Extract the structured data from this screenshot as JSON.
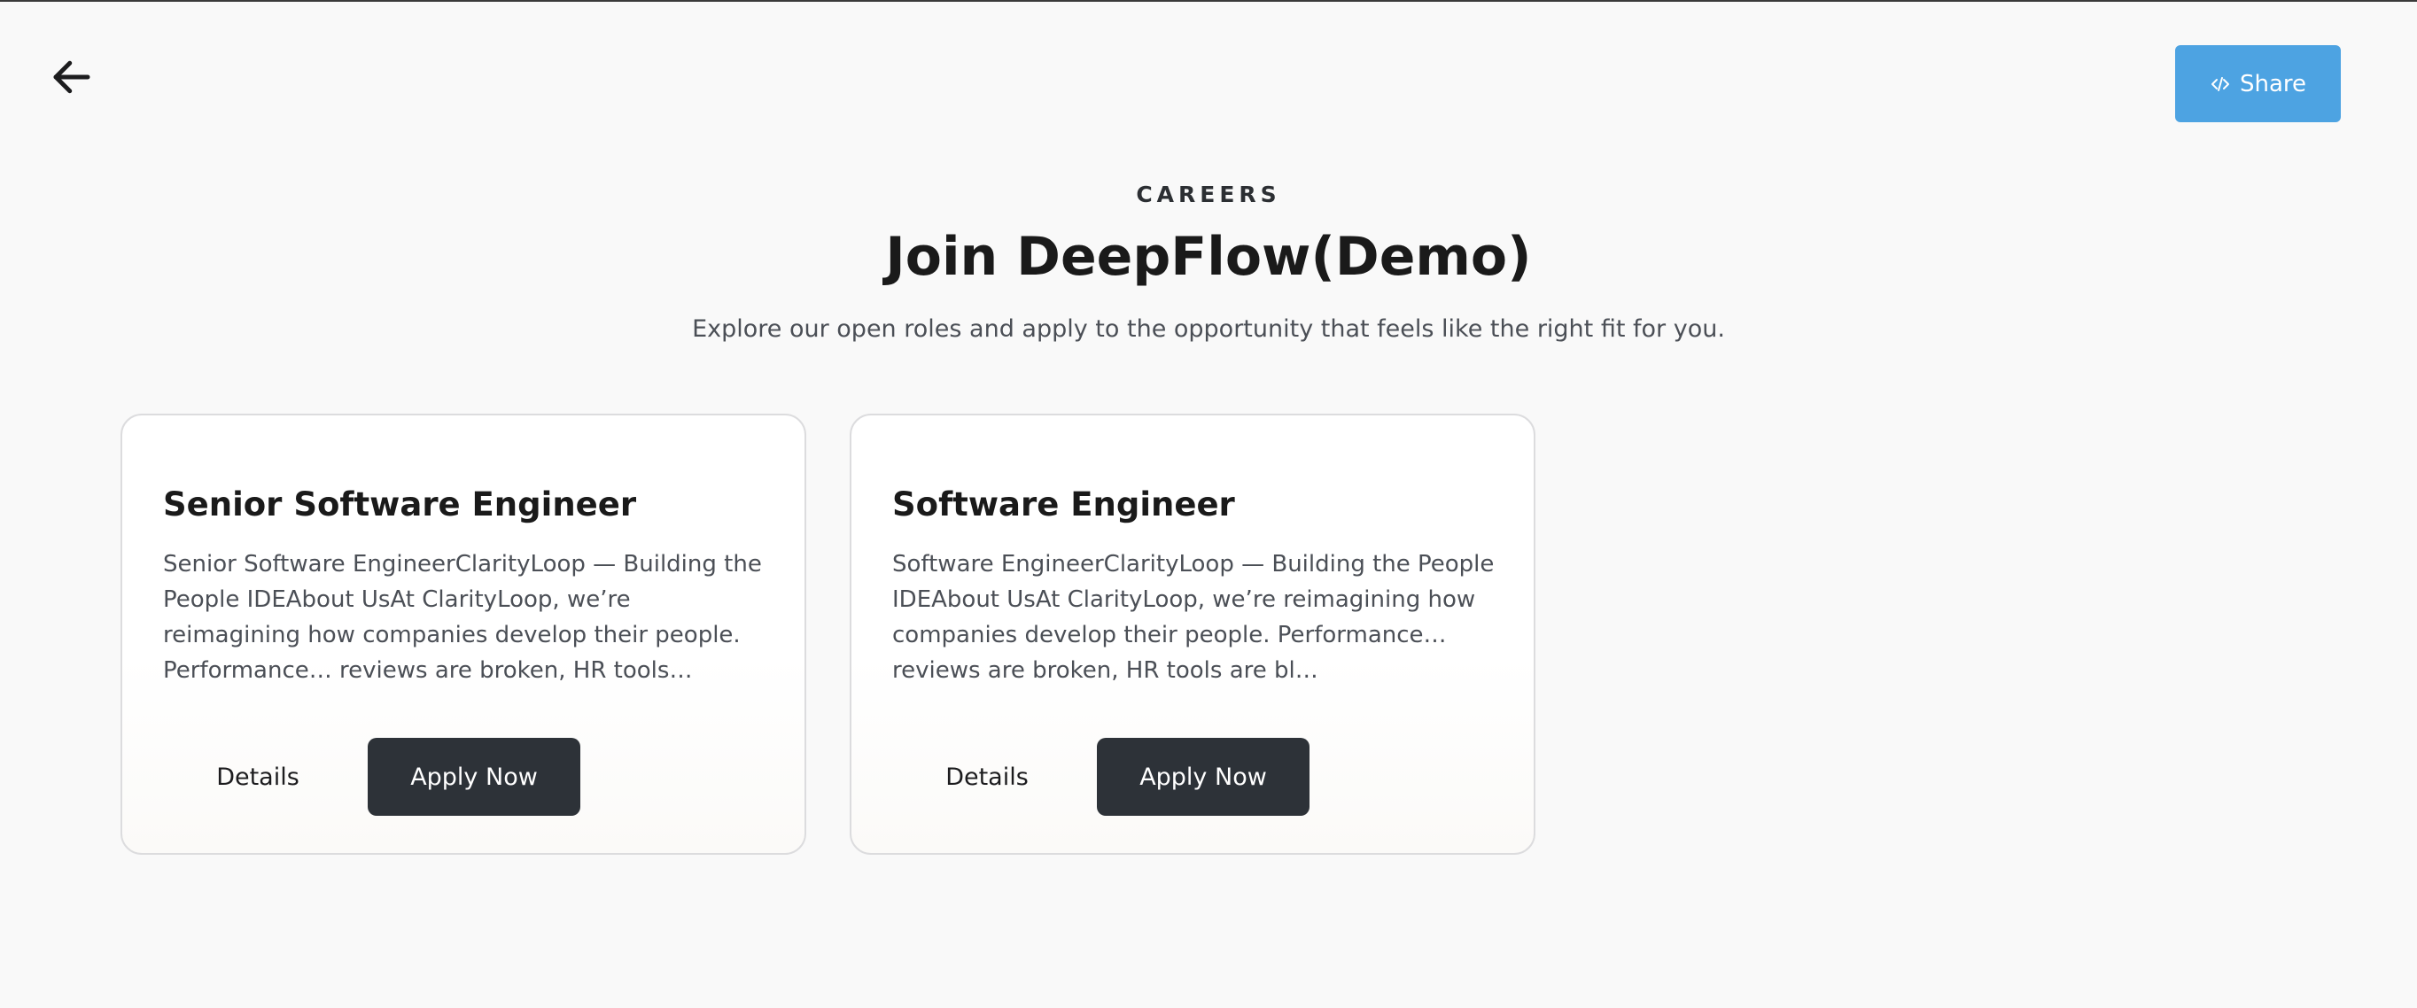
{
  "header": {
    "eyebrow": "CAREERS",
    "title": "Join DeepFlow(Demo)",
    "subtitle": "Explore our open roles and apply to the opportunity that feels like the right fit for you."
  },
  "toolbar": {
    "back_icon": "arrow-left-icon",
    "share_label": "Share",
    "share_icon": "code-icon"
  },
  "jobs": [
    {
      "title": "Senior Software Engineer",
      "description": "Senior Software EngineerClarityLoop — Building the People IDEAbout UsAt ClarityLoop, we’re reimagining how companies develop their people. Performance… reviews are broken, HR tools…",
      "details_label": "Details",
      "apply_label": "Apply Now"
    },
    {
      "title": "Software Engineer",
      "description": "Software EngineerClarityLoop — Building the People IDEAbout UsAt ClarityLoop, we’re reimagining how companies develop their people. Performance… reviews are broken, HR tools are bl…",
      "details_label": "Details",
      "apply_label": "Apply Now"
    }
  ],
  "colors": {
    "accent": "#4da3e2",
    "button_dark": "#2d3238",
    "background": "#f9f9f9"
  }
}
